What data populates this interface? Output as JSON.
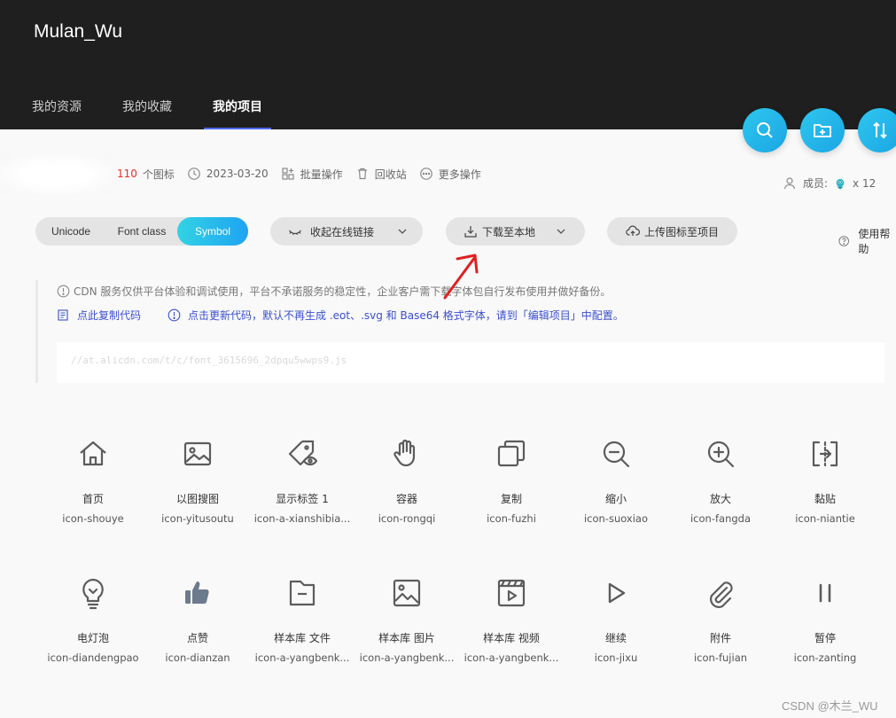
{
  "header": {
    "username": "Mulan_Wu",
    "tabs": [
      {
        "label": "我的资源",
        "active": false
      },
      {
        "label": "我的收藏",
        "active": false
      },
      {
        "label": "我的项目",
        "active": true
      }
    ],
    "fab_icons": [
      "search-icon",
      "folder-add-icon",
      "sort-icon"
    ]
  },
  "project": {
    "icon_count": "110",
    "icon_count_suffix": "个图标",
    "date": "2023-03-20",
    "batch_label": "批量操作",
    "recycle_label": "回收站",
    "more_label": "更多操作",
    "members_label": "成员:",
    "members_count": "x 12"
  },
  "toolbar": {
    "segments": [
      "Unicode",
      "Font class",
      "Symbol"
    ],
    "active_segment": "Symbol",
    "collapse_label": "收起在线链接",
    "download_label": "下载至本地",
    "upload_label": "上传图标至项目",
    "help_label": "使用帮助"
  },
  "notice": {
    "cdn_text": "CDN 服务仅供平台体验和调试使用，平台不承诺服务的稳定性，企业客户需下载字体包自行发布使用并做好备份。",
    "copy_label": "点此复制代码",
    "update_text": "点击更新代码，默认不再生成 .eot、.svg 和 Base64 格式字体，请到「编辑项目」中配置。",
    "code_url": "//at.alicdn.com/t/c/font_3615696_2dpqu5wwps9.js"
  },
  "icons": [
    {
      "cn": "首页",
      "en": "icon-shouye",
      "icon": "home-icon"
    },
    {
      "cn": "以图搜图",
      "en": "icon-yitusoutu",
      "icon": "image-icon"
    },
    {
      "cn": "显示标签 1",
      "en": "icon-a-xianshibia...",
      "icon": "tag-eye-icon"
    },
    {
      "cn": "容器",
      "en": "icon-rongqi",
      "icon": "hand-icon"
    },
    {
      "cn": "复制",
      "en": "icon-fuzhi",
      "icon": "copy-icon"
    },
    {
      "cn": "缩小",
      "en": "icon-suoxiao",
      "icon": "zoom-out-icon"
    },
    {
      "cn": "放大",
      "en": "icon-fangda",
      "icon": "zoom-in-icon"
    },
    {
      "cn": "黏贴",
      "en": "icon-niantie",
      "icon": "paste-icon"
    },
    {
      "cn": "电灯泡",
      "en": "icon-diandengpao",
      "icon": "bulb-icon"
    },
    {
      "cn": "点赞",
      "en": "icon-dianzan",
      "icon": "thumbs-up-icon"
    },
    {
      "cn": "样本库 文件",
      "en": "icon-a-yangbenk...",
      "icon": "file-icon"
    },
    {
      "cn": "样本库 图片",
      "en": "icon-a-yangbenk...",
      "icon": "picture-icon"
    },
    {
      "cn": "样本库 视频",
      "en": "icon-a-yangbenk...",
      "icon": "video-icon"
    },
    {
      "cn": "继续",
      "en": "icon-jixu",
      "icon": "play-icon"
    },
    {
      "cn": "附件",
      "en": "icon-fujian",
      "icon": "attachment-icon"
    },
    {
      "cn": "暂停",
      "en": "icon-zanting",
      "icon": "pause-icon"
    }
  ],
  "watermark": "CSDN @木兰_WU",
  "colors": {
    "header_bg": "#1f1f1f",
    "accent": "#1fa3f3",
    "count_red": "#e5322d",
    "link_blue": "#3a4fcf",
    "annotation_red": "#e02020"
  }
}
